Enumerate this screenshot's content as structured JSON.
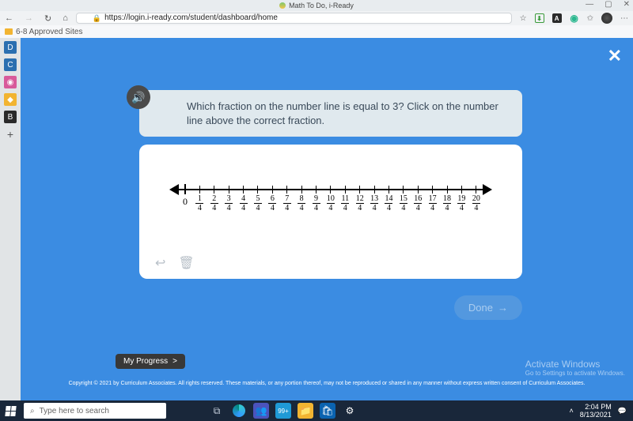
{
  "titlebar": {
    "title": "Math To Do, i-Ready",
    "min": "—",
    "max": "▢",
    "close": "✕"
  },
  "addressbar": {
    "back": "←",
    "fwd": "→",
    "reload": "↻",
    "home": "⌂",
    "url": "https://login.i-ready.com/student/dashboard/home",
    "star": "☆",
    "more": "⋯"
  },
  "bookmarks": {
    "item1": "6-8 Approved Sites"
  },
  "sidebar_icons": [
    "D",
    "C",
    "◉",
    "◆",
    "B",
    "+"
  ],
  "app": {
    "close": "✕",
    "question": "Which fraction on the number line is equal to 3? Click on the number line above the correct fraction.",
    "fractions": [
      {
        "t": "z",
        "v": "0"
      },
      {
        "t": "f",
        "n": "1",
        "d": "4"
      },
      {
        "t": "f",
        "n": "2",
        "d": "4"
      },
      {
        "t": "f",
        "n": "3",
        "d": "4"
      },
      {
        "t": "f",
        "n": "4",
        "d": "4"
      },
      {
        "t": "f",
        "n": "5",
        "d": "4"
      },
      {
        "t": "f",
        "n": "6",
        "d": "4"
      },
      {
        "t": "f",
        "n": "7",
        "d": "4"
      },
      {
        "t": "f",
        "n": "8",
        "d": "4"
      },
      {
        "t": "f",
        "n": "9",
        "d": "4"
      },
      {
        "t": "f",
        "n": "10",
        "d": "4"
      },
      {
        "t": "f",
        "n": "11",
        "d": "4"
      },
      {
        "t": "f",
        "n": "12",
        "d": "4"
      },
      {
        "t": "f",
        "n": "13",
        "d": "4"
      },
      {
        "t": "f",
        "n": "14",
        "d": "4"
      },
      {
        "t": "f",
        "n": "15",
        "d": "4"
      },
      {
        "t": "f",
        "n": "16",
        "d": "4"
      },
      {
        "t": "f",
        "n": "17",
        "d": "4"
      },
      {
        "t": "f",
        "n": "18",
        "d": "4"
      },
      {
        "t": "f",
        "n": "19",
        "d": "4"
      },
      {
        "t": "f",
        "n": "20",
        "d": "4"
      }
    ],
    "undo": "↩",
    "trash": "🗑",
    "done": "Done",
    "done_arrow": "→",
    "my_progress": "My Progress",
    "my_progress_arrow": ">"
  },
  "copyright": "Copyright © 2021 by Curriculum Associates. All rights reserved. These materials, or any portion thereof, may not be reproduced or shared in any manner without express written consent of Curriculum Associates.",
  "activate": {
    "title": "Activate Windows",
    "sub": "Go to Settings to activate Windows."
  },
  "taskbar": {
    "search_placeholder": "Type here to search",
    "time": "2:04 PM",
    "date": "8/13/2021"
  }
}
